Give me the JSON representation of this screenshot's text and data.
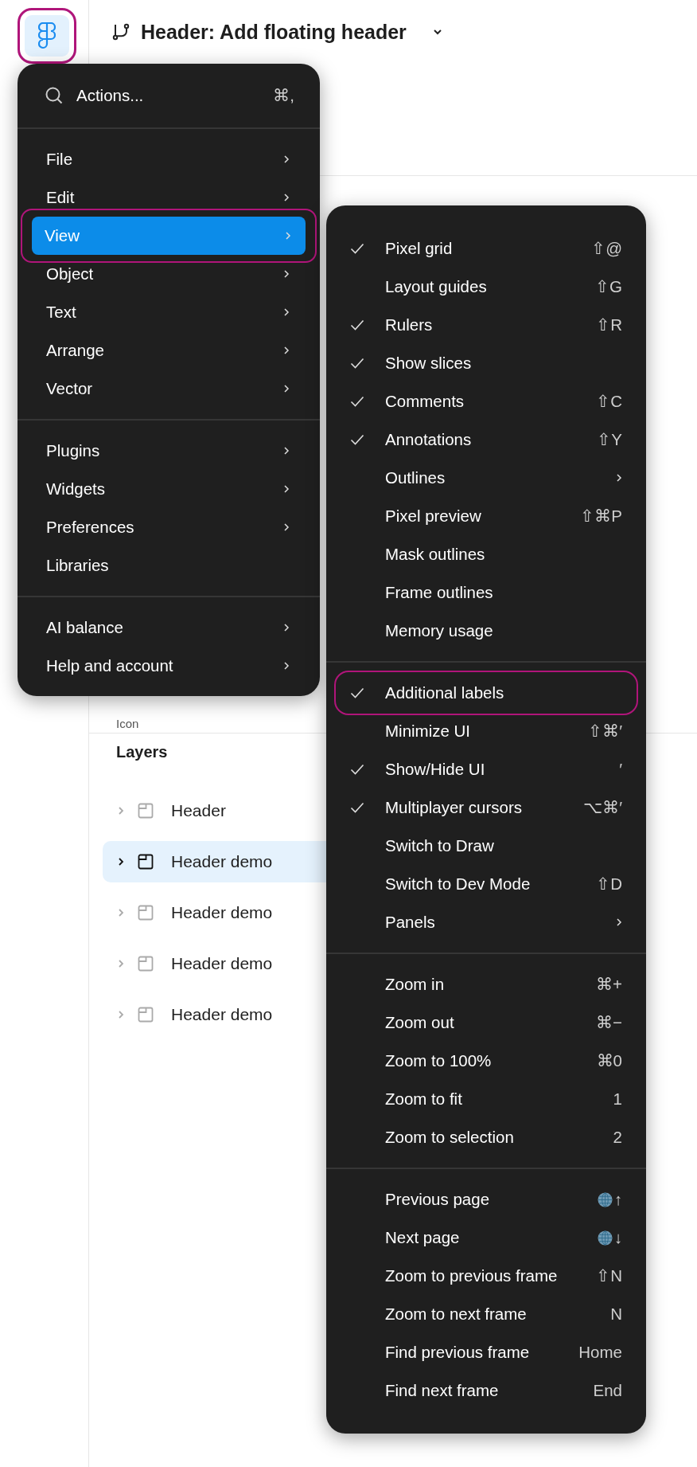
{
  "app_logo": {
    "highlighted": true
  },
  "header": {
    "title": "Header: Add floating header"
  },
  "panel": {
    "partial_label": "Icon",
    "layers_title": "Layers",
    "layers": [
      {
        "name": "Header",
        "selected": false
      },
      {
        "name": "Header demo",
        "selected": true
      },
      {
        "name": "Header demo",
        "selected": false
      },
      {
        "name": "Header demo",
        "selected": false
      },
      {
        "name": "Header demo",
        "selected": false
      }
    ]
  },
  "main_menu": {
    "search": {
      "label": "Actions...",
      "shortcut": "⌘,"
    },
    "sections": [
      [
        {
          "label": "File",
          "has_submenu": true,
          "selected": false,
          "highlighted": false
        },
        {
          "label": "Edit",
          "has_submenu": true,
          "selected": false,
          "highlighted": false
        },
        {
          "label": "View",
          "has_submenu": true,
          "selected": true,
          "highlighted": true
        },
        {
          "label": "Object",
          "has_submenu": true,
          "selected": false,
          "highlighted": false
        },
        {
          "label": "Text",
          "has_submenu": true,
          "selected": false,
          "highlighted": false
        },
        {
          "label": "Arrange",
          "has_submenu": true,
          "selected": false,
          "highlighted": false
        },
        {
          "label": "Vector",
          "has_submenu": true,
          "selected": false,
          "highlighted": false
        }
      ],
      [
        {
          "label": "Plugins",
          "has_submenu": true,
          "selected": false,
          "highlighted": false
        },
        {
          "label": "Widgets",
          "has_submenu": true,
          "selected": false,
          "highlighted": false
        },
        {
          "label": "Preferences",
          "has_submenu": true,
          "selected": false,
          "highlighted": false
        },
        {
          "label": "Libraries",
          "has_submenu": false,
          "selected": false,
          "highlighted": false
        }
      ],
      [
        {
          "label": "AI balance",
          "has_submenu": true,
          "selected": false,
          "highlighted": false
        },
        {
          "label": "Help and account",
          "has_submenu": true,
          "selected": false,
          "highlighted": false
        }
      ]
    ]
  },
  "view_menu": {
    "sections": [
      [
        {
          "label": "Pixel grid",
          "checked": true,
          "shortcut": "⇧@",
          "has_submenu": false,
          "highlighted": false
        },
        {
          "label": "Layout guides",
          "checked": false,
          "shortcut": "⇧G",
          "has_submenu": false,
          "highlighted": false
        },
        {
          "label": "Rulers",
          "checked": true,
          "shortcut": "⇧R",
          "has_submenu": false,
          "highlighted": false
        },
        {
          "label": "Show slices",
          "checked": true,
          "has_submenu": false,
          "highlighted": false
        },
        {
          "label": "Comments",
          "checked": true,
          "shortcut": "⇧C",
          "has_submenu": false,
          "highlighted": false
        },
        {
          "label": "Annotations",
          "checked": true,
          "shortcut": "⇧Y",
          "has_submenu": false,
          "highlighted": false
        },
        {
          "label": "Outlines",
          "checked": false,
          "has_submenu": true,
          "highlighted": false
        },
        {
          "label": "Pixel preview",
          "checked": false,
          "shortcut": "⇧⌘P",
          "has_submenu": false,
          "highlighted": false
        },
        {
          "label": "Mask outlines",
          "checked": false,
          "has_submenu": false,
          "highlighted": false
        },
        {
          "label": "Frame outlines",
          "checked": false,
          "has_submenu": false,
          "highlighted": false
        },
        {
          "label": "Memory usage",
          "checked": false,
          "has_submenu": false,
          "highlighted": false
        }
      ],
      [
        {
          "label": "Additional labels",
          "checked": true,
          "has_submenu": false,
          "highlighted": true
        },
        {
          "label": "Minimize UI",
          "checked": false,
          "shortcut": "⇧⌘′",
          "has_submenu": false,
          "highlighted": false
        },
        {
          "label": "Show/Hide UI",
          "checked": true,
          "shortcut": "′",
          "has_submenu": false,
          "highlighted": false
        },
        {
          "label": "Multiplayer cursors",
          "checked": true,
          "shortcut": "⌥⌘′",
          "has_submenu": false,
          "highlighted": false
        },
        {
          "label": "Switch to Draw",
          "checked": false,
          "has_submenu": false,
          "highlighted": false
        },
        {
          "label": "Switch to Dev Mode",
          "checked": false,
          "shortcut": "⇧D",
          "has_submenu": false,
          "highlighted": false
        },
        {
          "label": "Panels",
          "checked": false,
          "has_submenu": true,
          "highlighted": false
        }
      ],
      [
        {
          "label": "Zoom in",
          "checked": false,
          "shortcut": "⌘+",
          "has_submenu": false,
          "highlighted": false
        },
        {
          "label": "Zoom out",
          "checked": false,
          "shortcut": "⌘−",
          "has_submenu": false,
          "highlighted": false
        },
        {
          "label": "Zoom to 100%",
          "checked": false,
          "shortcut": "⌘0",
          "has_submenu": false,
          "highlighted": false
        },
        {
          "label": "Zoom to fit",
          "checked": false,
          "shortcut": "1",
          "has_submenu": false,
          "highlighted": false
        },
        {
          "label": "Zoom to selection",
          "checked": false,
          "shortcut": "2",
          "has_submenu": false,
          "highlighted": false
        }
      ],
      [
        {
          "label": "Previous page",
          "checked": false,
          "globe_key": true,
          "shortcut": "↑",
          "has_submenu": false,
          "highlighted": false
        },
        {
          "label": "Next page",
          "checked": false,
          "globe_key": true,
          "shortcut": "↓",
          "has_submenu": false,
          "highlighted": false
        },
        {
          "label": "Zoom to previous frame",
          "checked": false,
          "shortcut": "⇧N",
          "has_submenu": false,
          "highlighted": false
        },
        {
          "label": "Zoom to next frame",
          "checked": false,
          "shortcut": "N",
          "has_submenu": false,
          "highlighted": false
        },
        {
          "label": "Find previous frame",
          "checked": false,
          "shortcut": "Home",
          "has_submenu": false,
          "highlighted": false
        },
        {
          "label": "Find next frame",
          "checked": false,
          "shortcut": "End",
          "has_submenu": false,
          "highlighted": false
        }
      ]
    ]
  }
}
